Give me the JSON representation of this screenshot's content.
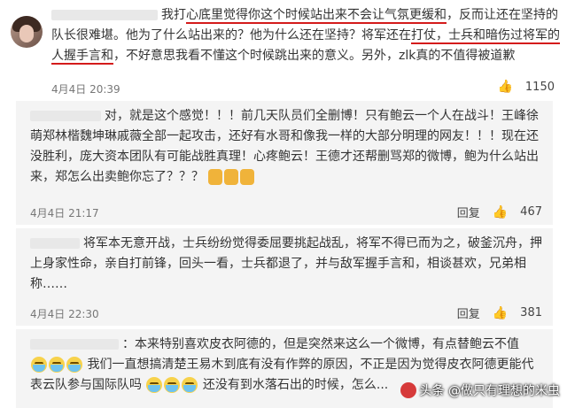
{
  "post": {
    "text_plain_1": "我打",
    "text_red_1": "心底里觉得你这个时候站出来不会让气氛更缓和",
    "text_plain_2": "，反而让还在坚持的队长很难堪。他为了什么站出来的？他为什么还在坚持？将军还在",
    "text_red_2": "打仗，士兵和暗伤过将军的人握手言和",
    "text_plain_3": "，不好意思我看不懂这个时候跳出来的意义。另外，zlk真的不值得被道歉",
    "time": "4月4日 20:39",
    "like_count": "1150"
  },
  "replies": [
    {
      "text": "对，就是这个感觉！！！前几天队员们全删博！只有鲍云一个人在战斗！王峰徐萌郑林楷魏坤琳戚薇全部一起攻击，还好有水哥和像我一样的大部分明理的网友！！！现在还没胜利，庞大资本团队有可能战胜真理！心疼鲍云！王德才还帮删骂郑的微博，鲍为什么站出来，郑怎么出卖鲍你忘了？？？",
      "time": "4月4日 21:17",
      "reply_label": "回复",
      "like_count": "467"
    },
    {
      "text": "将军本无意开战，士兵纷纷觉得委屈要挑起战乱，将军不得已而为之，破釜沉舟，押上身家性命，亲自打前锋，回头一看，士兵都退了，并与敌军握手言和，相谈甚欢，兄弟相称……",
      "time": "4月4日 22:30",
      "reply_label": "回复",
      "like_count": "381"
    },
    {
      "text_1": "：本来特别喜欢皮衣阿德的，但是突然来这么一个微博，有点替鲍云不值",
      "text_2": "我们一直想搞清楚王易木到底有没有作弊的原因，不正是因为觉得皮衣阿德更能代表云队参与国际队吗",
      "text_3": "还没有到水落石出的时候，怎么..."
    }
  ],
  "watermark": "头条 @做只有理想的米虫",
  "icons": [
    "thumb-up-icon",
    "emoji-icon",
    "toutiao-logo-icon"
  ],
  "colors": {
    "underline": "#d41b1b",
    "reply_bg": "#f4f4f4"
  }
}
